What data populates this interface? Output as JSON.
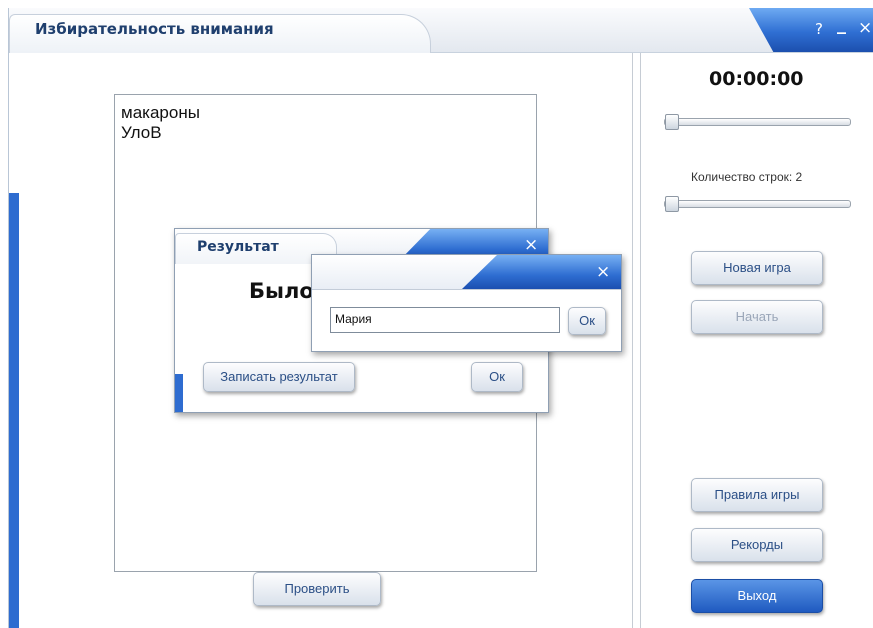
{
  "window": {
    "title": "Избирательность внимания",
    "help": "?",
    "minimize": "_",
    "close": "×"
  },
  "words": [
    "макароны",
    "УлоВ"
  ],
  "sidebar": {
    "timer": "00:00:00",
    "rows_label": "Количество строк: 2",
    "new_game": "Новая игра",
    "start": "Начать",
    "rules": "Правила игры",
    "records": "Рекорды",
    "exit": "Выход"
  },
  "check_button": "Проверить",
  "result_dialog": {
    "title": "Результат",
    "message": "Было",
    "save_button": "Записать результат",
    "ok_button": "Ок",
    "close": "×"
  },
  "name_dialog": {
    "name_value": "Мария",
    "ok_button": "Ок",
    "close": "×"
  },
  "colors": {
    "accent": "#2e6dd1",
    "title_text": "#1f3f6e"
  }
}
